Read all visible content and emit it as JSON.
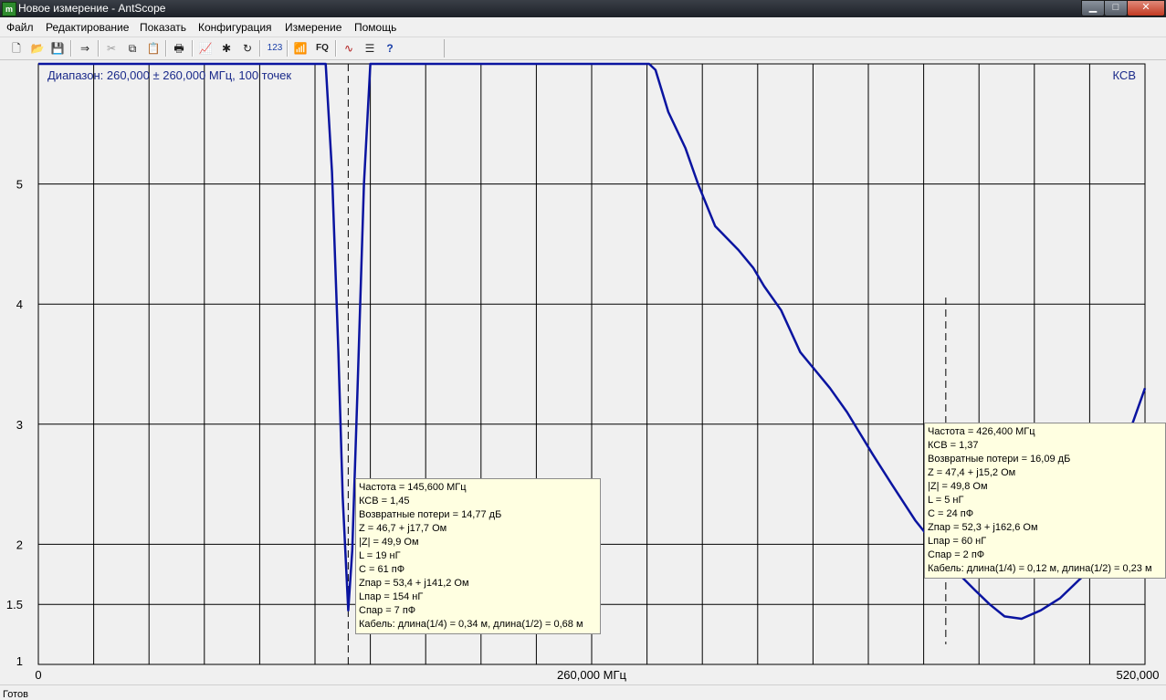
{
  "window": {
    "title": "Новое измерение - AntScope",
    "icon_glyph": "m",
    "controls": {
      "minimize": "▁",
      "maximize": "□",
      "close": "✕"
    }
  },
  "menu": [
    "Файл",
    "Редактирование",
    "Показать",
    "Конфигурация",
    "Измерение",
    "Помощь"
  ],
  "toolbar": [
    {
      "name": "new-icon",
      "glyph": "🗋",
      "enabled": true
    },
    {
      "name": "open-icon",
      "glyph": "📂",
      "enabled": true
    },
    {
      "name": "save-icon",
      "glyph": "💾",
      "enabled": true
    },
    {
      "name": "export-icon",
      "glyph": "⇒",
      "enabled": true
    },
    {
      "name": "cut-icon",
      "glyph": "✂",
      "enabled": false
    },
    {
      "name": "copy-icon",
      "glyph": "⧉",
      "enabled": true
    },
    {
      "name": "paste-icon",
      "glyph": "📋",
      "enabled": false
    },
    {
      "name": "print-icon",
      "glyph": "🖶",
      "enabled": true
    },
    {
      "name": "chart-icon",
      "glyph": "📈",
      "enabled": true
    },
    {
      "name": "scan-icon",
      "glyph": "✱",
      "enabled": true
    },
    {
      "name": "refresh-icon",
      "glyph": "↻",
      "enabled": true
    },
    {
      "name": "digits-icon",
      "glyph": "123",
      "enabled": true
    },
    {
      "name": "antenna-icon",
      "glyph": "📶",
      "enabled": true
    },
    {
      "name": "fq-icon",
      "glyph": "FQ",
      "enabled": true
    },
    {
      "name": "wave-icon",
      "glyph": "∿",
      "enabled": true
    },
    {
      "name": "list-icon",
      "glyph": "☰",
      "enabled": true
    },
    {
      "name": "help-icon",
      "glyph": "?",
      "enabled": true
    }
  ],
  "chart": {
    "range_label": "Диапазон: 260,000 ± 260,000 МГц, 100 точек",
    "mode_label": "КСВ"
  },
  "chart_data": {
    "type": "line",
    "title": "Диапазон: 260,000 ± 260,000 МГц, 100 точек",
    "ylabel": "КСВ",
    "xlim": [
      0,
      520
    ],
    "ylim": [
      1,
      6
    ],
    "x_ticks": [
      "0",
      "260,000 МГц",
      "520,000"
    ],
    "y_ticks": [
      {
        "value": 1.5,
        "label": "1.5"
      },
      {
        "value": 2,
        "label": "2"
      },
      {
        "value": 3,
        "label": "3"
      },
      {
        "value": 4,
        "label": "4"
      },
      {
        "value": 5,
        "label": "5"
      }
    ],
    "y_tick_label_1": "1",
    "grid": true,
    "series": [
      {
        "color": "#0a14a0",
        "x": [
          0,
          135,
          138,
          141,
          143,
          145.6,
          147.5,
          150,
          153,
          156,
          287,
          290,
          296,
          304,
          310,
          318,
          329,
          336,
          341,
          349,
          358,
          372,
          380,
          392,
          401,
          412,
          421,
          426.4,
          431,
          440,
          447,
          454,
          462,
          471,
          480,
          490,
          499,
          504,
          508,
          514,
          520
        ],
        "y": [
          6,
          6,
          5.1,
          3.6,
          2.4,
          1.45,
          1.95,
          3.3,
          5.0,
          6,
          6,
          5.95,
          5.6,
          5.3,
          5.0,
          4.65,
          4.45,
          4.3,
          4.15,
          3.95,
          3.6,
          3.3,
          3.1,
          2.75,
          2.5,
          2.2,
          2.0,
          1.9,
          1.78,
          1.62,
          1.5,
          1.4,
          1.38,
          1.45,
          1.55,
          1.72,
          1.95,
          2.2,
          2.55,
          3.0,
          3.3
        ]
      }
    ],
    "markers": [
      {
        "x": 145.6
      },
      {
        "x": 426.4
      }
    ]
  },
  "tooltips": [
    {
      "lines": [
        "Частота = 145,600 МГц",
        "КСВ = 1,45",
        "Возвратные потери = 14,77 дБ",
        "Z = 46,7 + j17,7 Ом",
        "|Z| = 49,9 Ом",
        "L = 19 нГ",
        "C = 61 пФ",
        "Zпар = 53,4 + j141,2 Ом",
        "Lпар = 154 нГ",
        "Cпар = 7 пФ",
        "Кабель: длина(1/4) = 0,34 м, длина(1/2) = 0,68 м"
      ]
    },
    {
      "lines": [
        "Частота = 426,400 МГц",
        "КСВ = 1,37",
        "Возвратные потери = 16,09 дБ",
        "Z = 47,4 + j15,2 Ом",
        "|Z| = 49,8 Ом",
        "L = 5 нГ",
        "C = 24 пФ",
        "Zпар = 52,3 + j162,6 Ом",
        "Lпар = 60 нГ",
        "Cпар = 2 пФ",
        "Кабель: длина(1/4) = 0,12 м, длина(1/2) = 0,23 м"
      ]
    }
  ],
  "status": {
    "text": "Готов"
  }
}
